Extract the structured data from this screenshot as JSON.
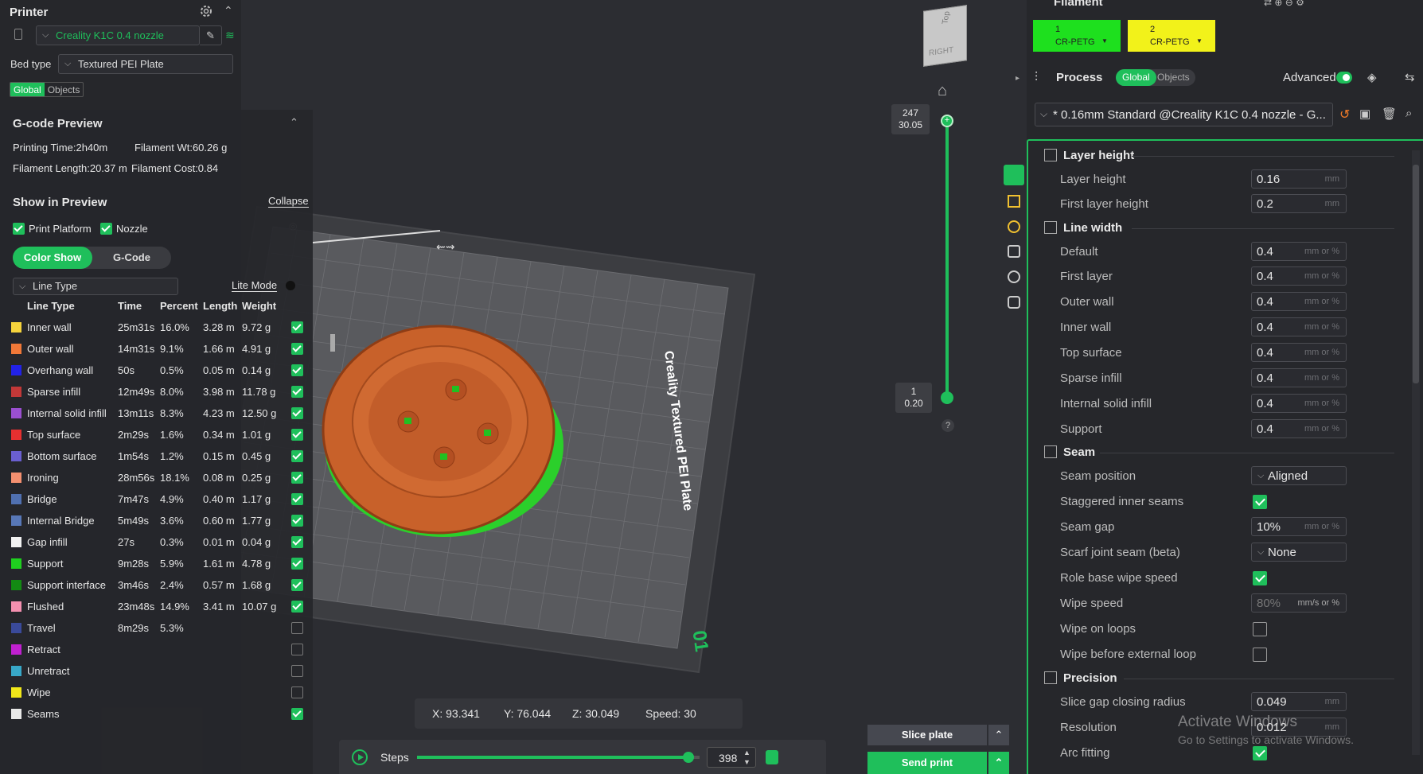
{
  "printer": {
    "title": "Printer",
    "name": "Creality K1C 0.4 nozzle",
    "bed_type_label": "Bed type",
    "bed_type": "Textured PEI Plate",
    "tab_global": "Global",
    "tab_objects": "Objects"
  },
  "gcode_preview": {
    "title": "G-code Preview",
    "printing_time": "Printing Time:2h40m",
    "filament_wt": "Filament Wt:60.26 g",
    "filament_length": "Filament Length:20.37 m",
    "filament_cost": "Filament Cost:0.84",
    "show_in_preview": "Show in Preview",
    "collapse": "Collapse",
    "print_platform": "Print Platform",
    "nozzle": "Nozzle",
    "color_show": "Color Show",
    "gcode": "G-Code",
    "line_type_select": "Line Type",
    "lite_mode": "Lite Mode",
    "columns": [
      "Line Type",
      "Time",
      "Percent",
      "Length",
      "Weight"
    ],
    "rows": [
      {
        "name": "Inner wall",
        "time": "25m31s",
        "percent": "16.0%",
        "length": "3.28 m",
        "weight": "9.72 g",
        "color": "#f5d33c",
        "checked": true
      },
      {
        "name": "Outer wall",
        "time": "14m31s",
        "percent": "9.1%",
        "length": "1.66 m",
        "weight": "4.91 g",
        "color": "#f07838",
        "checked": true
      },
      {
        "name": "Overhang wall",
        "time": "50s",
        "percent": "0.5%",
        "length": "0.05 m",
        "weight": "0.14 g",
        "color": "#2222e8",
        "checked": true
      },
      {
        "name": "Sparse infill",
        "time": "12m49s",
        "percent": "8.0%",
        "length": "3.98 m",
        "weight": "11.78 g",
        "color": "#c23838",
        "checked": true
      },
      {
        "name": "Internal solid infill",
        "time": "13m11s",
        "percent": "8.3%",
        "length": "4.23 m",
        "weight": "12.50 g",
        "color": "#9a4fd0",
        "checked": true
      },
      {
        "name": "Top surface",
        "time": "2m29s",
        "percent": "1.6%",
        "length": "0.34 m",
        "weight": "1.01 g",
        "color": "#e63030",
        "checked": true
      },
      {
        "name": "Bottom surface",
        "time": "1m54s",
        "percent": "1.2%",
        "length": "0.15 m",
        "weight": "0.45 g",
        "color": "#6a5fd0",
        "checked": true
      },
      {
        "name": "Ironing",
        "time": "28m56s",
        "percent": "18.1%",
        "length": "0.08 m",
        "weight": "0.25 g",
        "color": "#f49070",
        "checked": true
      },
      {
        "name": "Bridge",
        "time": "7m47s",
        "percent": "4.9%",
        "length": "0.40 m",
        "weight": "1.17 g",
        "color": "#5070b0",
        "checked": true
      },
      {
        "name": "Internal Bridge",
        "time": "5m49s",
        "percent": "3.6%",
        "length": "0.60 m",
        "weight": "1.77 g",
        "color": "#5878b8",
        "checked": true
      },
      {
        "name": "Gap infill",
        "time": "27s",
        "percent": "0.3%",
        "length": "0.01 m",
        "weight": "0.04 g",
        "color": "#f2f2f2",
        "checked": true
      },
      {
        "name": "Support",
        "time": "9m28s",
        "percent": "5.9%",
        "length": "1.61 m",
        "weight": "4.78 g",
        "color": "#1fd01f",
        "checked": true
      },
      {
        "name": "Support interface",
        "time": "3m46s",
        "percent": "2.4%",
        "length": "0.57 m",
        "weight": "1.68 g",
        "color": "#138a13",
        "checked": true
      },
      {
        "name": "Flushed",
        "time": "23m48s",
        "percent": "14.9%",
        "length": "3.41 m",
        "weight": "10.07 g",
        "color": "#f490b0",
        "checked": true
      },
      {
        "name": "Travel",
        "time": "8m29s",
        "percent": "5.3%",
        "length": "",
        "weight": "",
        "color": "#3a4a9a",
        "checked": false
      },
      {
        "name": "Retract",
        "time": "",
        "percent": "",
        "length": "",
        "weight": "",
        "color": "#c020d0",
        "checked": false
      },
      {
        "name": "Unretract",
        "time": "",
        "percent": "",
        "length": "",
        "weight": "",
        "color": "#38a8c8",
        "checked": false
      },
      {
        "name": "Wipe",
        "time": "",
        "percent": "",
        "length": "",
        "weight": "",
        "color": "#f2e81a",
        "checked": false
      },
      {
        "name": "Seams",
        "time": "",
        "percent": "",
        "length": "",
        "weight": "",
        "color": "#e8e8e8",
        "checked": true
      }
    ]
  },
  "viewport": {
    "plate_label": "Creality Textured PEI Plate",
    "plate_number": "01",
    "layer_top": "247",
    "layer_top_height": "30.05",
    "layer_bottom": "1",
    "layer_bottom_height": "0.20",
    "help": "?",
    "cube_top": "Top",
    "cube_right": "RIGHT",
    "coords": {
      "x": "X: 93.341",
      "y": "Y: 76.044",
      "z": "Z: 30.049",
      "speed": "Speed: 30"
    },
    "steps_label": "Steps",
    "steps_value": "398",
    "steps_fraction": 0.96,
    "slice_plate": "Slice plate",
    "send_print": "Send print"
  },
  "filament": {
    "title": "Filament",
    "slots": [
      {
        "index": "1",
        "type": "CR-PETG",
        "color": "#1ee01e"
      },
      {
        "index": "2",
        "type": "CR-PETG",
        "color": "#f2f21a"
      }
    ]
  },
  "process": {
    "title": "Process",
    "tab_global": "Global",
    "tab_objects": "Objects",
    "advanced": "Advanced",
    "preset": "* 0.16mm Standard @Creality K1C 0.4 nozzle - G..."
  },
  "settings": {
    "layer_height_header": "Layer height",
    "line_width_header": "Line width",
    "seam_header": "Seam",
    "precision_header": "Precision",
    "unit_mm": "mm",
    "unit_mm_pct": "mm or %",
    "unit_speed": "mm/s or %",
    "layer_height": {
      "label": "Layer height",
      "value": "0.16"
    },
    "first_layer_height": {
      "label": "First layer height",
      "value": "0.2"
    },
    "lw_default": {
      "label": "Default",
      "value": "0.4"
    },
    "lw_first_layer": {
      "label": "First layer",
      "value": "0.4"
    },
    "lw_outer_wall": {
      "label": "Outer wall",
      "value": "0.4"
    },
    "lw_inner_wall": {
      "label": "Inner wall",
      "value": "0.4"
    },
    "lw_top_surface": {
      "label": "Top surface",
      "value": "0.4"
    },
    "lw_sparse_infill": {
      "label": "Sparse infill",
      "value": "0.4"
    },
    "lw_internal_solid": {
      "label": "Internal solid infill",
      "value": "0.4"
    },
    "lw_support": {
      "label": "Support",
      "value": "0.4"
    },
    "seam_position": {
      "label": "Seam position",
      "value": "Aligned"
    },
    "staggered": {
      "label": "Staggered inner seams",
      "checked": true
    },
    "seam_gap": {
      "label": "Seam gap",
      "value": "10%"
    },
    "scarf": {
      "label": "Scarf joint seam (beta)",
      "value": "None"
    },
    "role_wipe": {
      "label": "Role base wipe speed",
      "checked": true
    },
    "wipe_speed": {
      "label": "Wipe speed",
      "value": "80%"
    },
    "wipe_loops": {
      "label": "Wipe on loops",
      "checked": false
    },
    "wipe_before": {
      "label": "Wipe before external loop",
      "checked": false
    },
    "slice_gap": {
      "label": "Slice gap closing radius",
      "value": "0.049"
    },
    "resolution": {
      "label": "Resolution",
      "value": "0.012"
    },
    "arc_fitting": {
      "label": "Arc fitting",
      "checked": true
    }
  },
  "watermark": {
    "line1": "Activate Windows",
    "line2": "Go to Settings to activate Windows."
  }
}
